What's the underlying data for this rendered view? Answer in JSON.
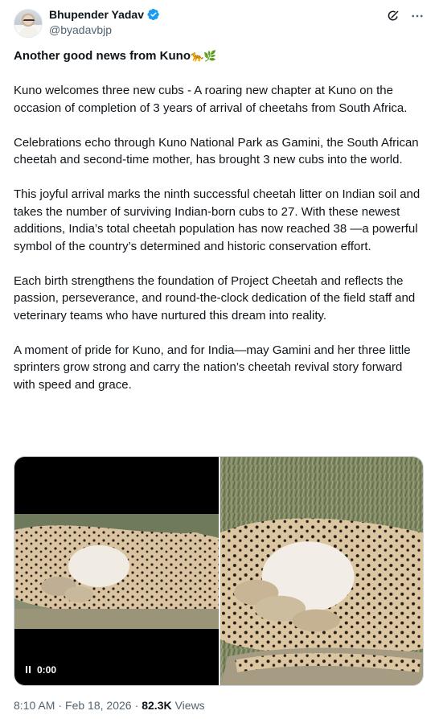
{
  "author": {
    "name": "Bhupender Yadav",
    "handle": "@byadavbjp",
    "verified": true
  },
  "actions": {
    "grok_icon": "grok-icon",
    "more_icon": "more-icon"
  },
  "tweet": {
    "headline": "Another good news from Kuno",
    "headline_emojis": "🐆🌿",
    "paragraphs": [
      "Kuno welcomes three new cubs - A roaring new chapter at Kuno on the occasion of completion of 3 years of arrival of cheetahs from South Africa.",
      "Celebrations echo through Kuno National Park as Gamini, the South African cheetah and second-time mother, has brought 3 new cubs into the world.",
      "This joyful arrival marks the ninth successful cheetah litter on Indian soil and takes the number of surviving Indian-born cubs to 27. With these newest additions, India’s total cheetah population has now reached 38 —a powerful symbol of the country’s determined and historic conservation effort.",
      "Each birth strengthens the foundation of Project Cheetah and reflects the passion, perseverance, and round-the-clock dedication of the field staff and veterinary teams who have nurtured this dream into reality.",
      "A moment of pride for Kuno, and for India—may Gamini and her three little sprinters grow strong and carry the nation’s cheetah revival story forward with speed and grace."
    ]
  },
  "media": {
    "video_time": "0:00"
  },
  "meta": {
    "time": "8:10 AM",
    "separator": "·",
    "date": "Feb 18, 2026",
    "views_count": "82.3K",
    "views_label": "Views"
  },
  "colors": {
    "text": "#0f1419",
    "secondary": "#536471",
    "verified_blue": "#1d9bf0",
    "border": "#cfd9de"
  }
}
